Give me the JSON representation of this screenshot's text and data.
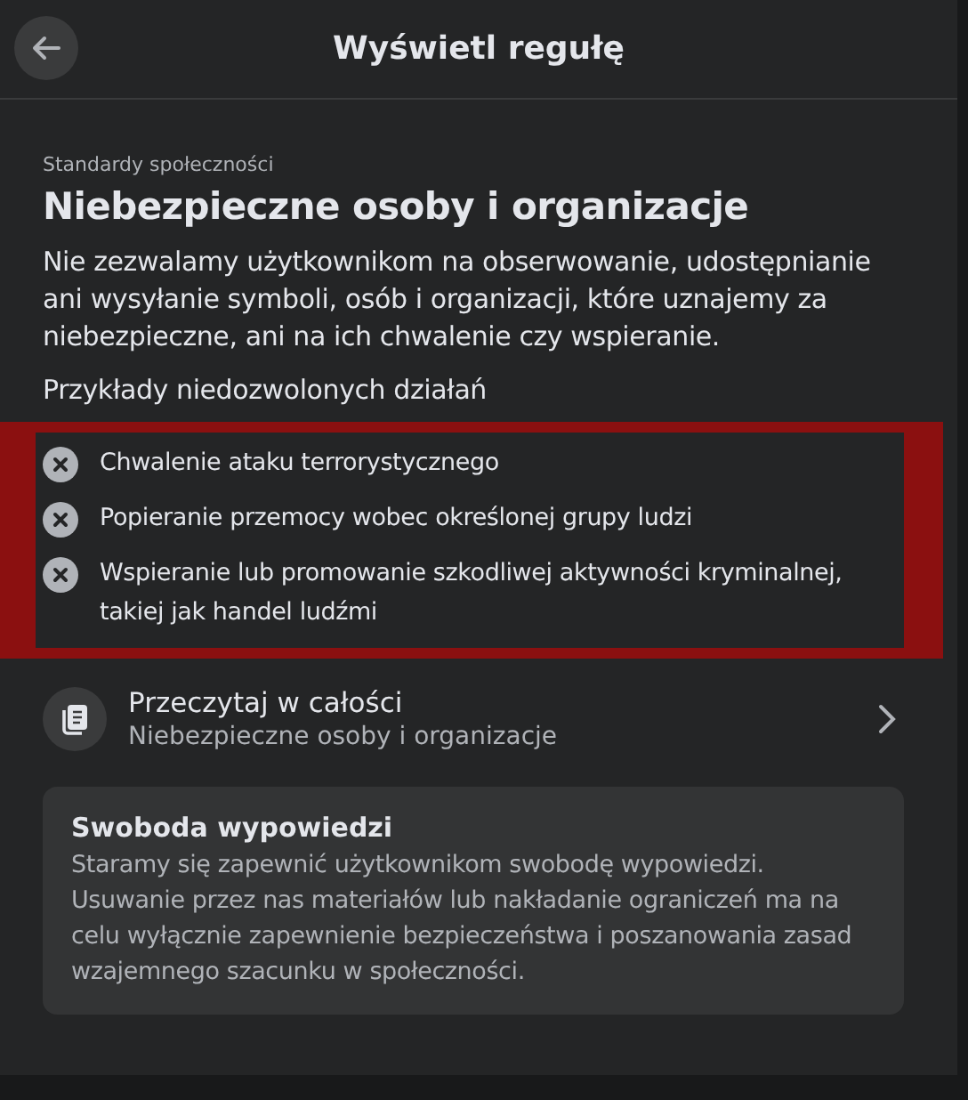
{
  "header": {
    "title": "Wyświetl regułę"
  },
  "category": "Standardy społeczności",
  "title": "Niebezpieczne osoby i organizacje",
  "description": "Nie zezwalamy użytkownikom na obserwowanie, udostępnianie ani wysyłanie symboli, osób i organizacji, które uznajemy za niebezpieczne, ani na ich chwalenie czy wspieranie.",
  "examples": {
    "heading": "Przykłady niedozwolonych działań",
    "highlighted": true,
    "items": [
      "Chwalenie ataku terrorystycznego",
      "Popieranie przemocy wobec określonej grupy ludzi",
      "Wspieranie lub promowanie szkodliwej aktywności kryminalnej, takiej jak handel ludźmi"
    ]
  },
  "read_more": {
    "title": "Przeczytaj w całości",
    "subtitle": "Niebezpieczne osoby i organizacje"
  },
  "note": {
    "title": "Swoboda wypowiedzi",
    "text": "Staramy się zapewnić użytkownikom swobodę wypowiedzi. Usuwanie przez nas materiałów lub nakładanie ograniczeń ma na celu wyłącznie zapewnienie bezpieczeństwa i poszanowania zasad wzajemnego szacunku w społeczności."
  }
}
